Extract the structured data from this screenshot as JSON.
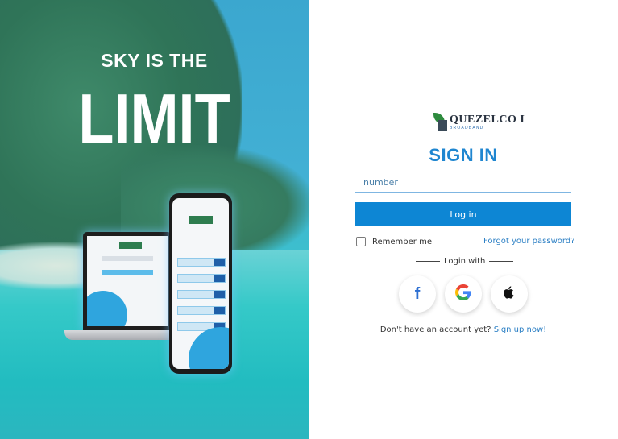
{
  "hero": {
    "slogan_line1": "SKY IS THE",
    "slogan_line2": "LIMIT"
  },
  "brand": {
    "name": "QUEZELCO I",
    "sub": "BROADBAND"
  },
  "form": {
    "title": "SIGN IN",
    "number_placeholder": "number",
    "number_value": "",
    "login_label": "Log in",
    "remember_label": "Remember me",
    "remember_checked": false,
    "forgot_label": "Forgot your password?",
    "login_with_label": "Login with"
  },
  "social": {
    "facebook_icon": "facebook-icon",
    "google_icon": "google-icon",
    "apple_icon": "apple-icon"
  },
  "signup": {
    "prompt": "Don't have an account yet?",
    "link_label": "Sign up now!"
  },
  "colors": {
    "accent": "#0d86d4",
    "title": "#1f86d0",
    "link": "#2b7fc4"
  }
}
